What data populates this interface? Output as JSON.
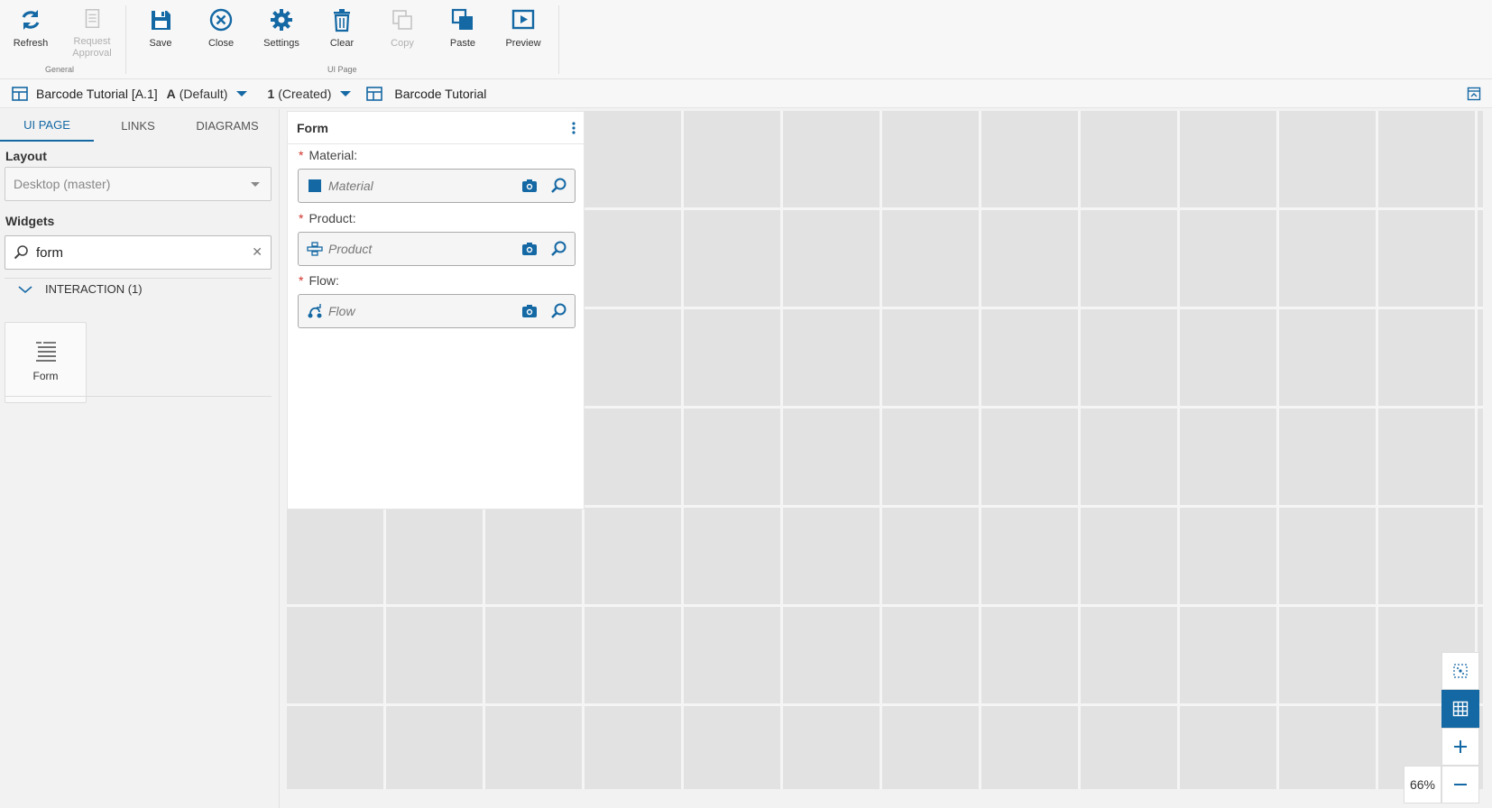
{
  "toolbar": {
    "groups": [
      {
        "label": "General"
      },
      {
        "label": "UI Page"
      }
    ],
    "buttons": [
      {
        "label": "Refresh",
        "icon": "refresh-icon",
        "enabled": true
      },
      {
        "label": "Request\nApproval",
        "icon": "document-icon",
        "enabled": false
      },
      {
        "label": "Save",
        "icon": "save-icon",
        "enabled": true
      },
      {
        "label": "Close",
        "icon": "close-circle-icon",
        "enabled": true
      },
      {
        "label": "Settings",
        "icon": "gear-icon",
        "enabled": true
      },
      {
        "label": "Clear",
        "icon": "trash-icon",
        "enabled": true
      },
      {
        "label": "Copy",
        "icon": "copy-icon",
        "enabled": false
      },
      {
        "label": "Paste",
        "icon": "paste-icon",
        "enabled": true
      },
      {
        "label": "Preview",
        "icon": "play-icon",
        "enabled": true
      }
    ]
  },
  "breadcrumb": {
    "page_name": "Barcode Tutorial [A.1]",
    "version_letter": "A",
    "version_label": "(Default)",
    "revision_number": "1",
    "revision_label": "(Created)",
    "page_title": "Barcode Tutorial"
  },
  "left_panel": {
    "tabs": [
      {
        "label": "UI PAGE",
        "active": true
      },
      {
        "label": "LINKS",
        "active": false
      },
      {
        "label": "DIAGRAMS",
        "active": false
      }
    ],
    "layout_title": "Layout",
    "layout_value": "Desktop (master)",
    "widgets_title": "Widgets",
    "widget_search": "form",
    "group_label": "INTERACTION (1)",
    "widget_items": [
      {
        "label": "Form",
        "icon": "form-list-icon"
      }
    ]
  },
  "form_widget": {
    "title": "Form",
    "fields": [
      {
        "label": "Material:",
        "placeholder": "Material",
        "required": true,
        "icon": "material-square-icon"
      },
      {
        "label": "Product:",
        "placeholder": "Product",
        "required": true,
        "icon": "product-icon"
      },
      {
        "label": "Flow:",
        "placeholder": "Flow",
        "required": true,
        "icon": "flow-icon"
      }
    ]
  },
  "zoom": {
    "level": "66%"
  },
  "colors": {
    "accent": "#1468a4",
    "required": "#d0342c",
    "canvas_cell": "#e2e2e2"
  }
}
